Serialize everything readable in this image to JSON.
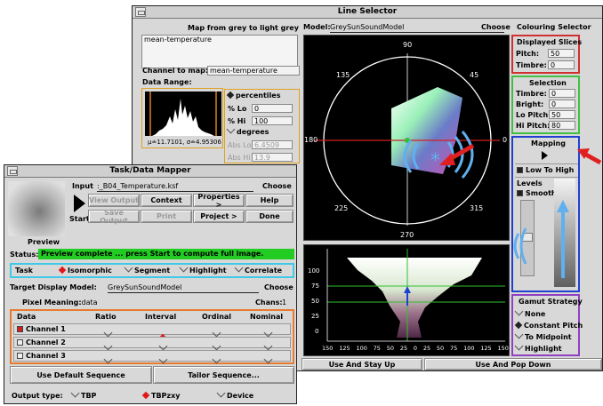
{
  "line_selector": {
    "title": "Line Selector",
    "map_header": "Map from grey to light grey",
    "map_list_item": "mean-temperature",
    "channel_label": "Channel to map:",
    "channel_value": "mean-temperature",
    "data_range_label": "Data Range:",
    "hist_stats": "μ≐11.7101, σ≐4.95306",
    "percentiles_label": "percentiles",
    "lo_label": "% Lo",
    "lo_value": "0",
    "hi_label": "% Hi",
    "hi_value": "100",
    "degrees_label": "degrees",
    "abs_lo_label": "Abs Lo",
    "abs_lo_value": "6.4509",
    "abs_hi_label": "Abs Hi",
    "abs_hi_value": "13.9",
    "model_label": "Model:",
    "model_value": "GreySunSoundModel",
    "choose_label": "Choose",
    "polar_labels": {
      "top": "90",
      "tr": "45",
      "left": "180",
      "right": "0",
      "bl": "225",
      "br": "315",
      "bottom": "270",
      "tl": "135"
    },
    "y_ticks": [
      "100",
      "75",
      "50",
      "25",
      "0"
    ],
    "x_ticks": [
      "150",
      "125",
      "100",
      "75",
      "50",
      "25",
      "0",
      "25",
      "50",
      "75",
      "100",
      "125",
      "150"
    ],
    "stay_up_label": "Use And Stay Up",
    "pop_down_label": "Use And Pop Down"
  },
  "colouring_selector": {
    "title": "Colouring Selector",
    "displayed_slices_label": "Displayed Slices",
    "pitch_label": "Pitch:",
    "pitch_value": "50",
    "timbre_label": "Timbre:",
    "timbre_value": "0",
    "selection_label": "Selection",
    "sel_timbre_label": "Timbre:",
    "sel_timbre_value": "0",
    "bright_label": "Bright:",
    "bright_value": "0",
    "lo_pitch_label": "Lo Pitch:",
    "lo_pitch_value": "50",
    "hi_pitch_label": "Hi Pitch:",
    "hi_pitch_value": "80",
    "mapping_label": "Mapping",
    "low_to_high_label": "Low To High",
    "levels_label": "Levels",
    "smooth_label": "Smooth",
    "gamut_label": "Gamut Strategy",
    "gamut_options": [
      "None",
      "Constant Pitch",
      "To Midpoint",
      "Highlight"
    ]
  },
  "task_mapper": {
    "title": "Task/Data Mapper",
    "input_label": "Input",
    "input_file": ":_B04_Temperature.ksf",
    "choose_label": "Choose",
    "start_label": "Start",
    "view_output_label": "View Output",
    "context_label": "Context",
    "properties_label": "Properties >",
    "help_label": "Help",
    "save_output_label": "Save Output",
    "print_label": "Print",
    "project_label": "Project >",
    "done_label": "Done",
    "preview_label": "Preview",
    "status_label": "Status:",
    "status_text": "Preview complete ... press Start to compute full image.",
    "task_label": "Task",
    "task_options": [
      "Isomorphic",
      "Segment",
      "Highlight",
      "Correlate"
    ],
    "target_model_label": "Target Display Model:",
    "target_model_value": "GreySunSoundModel",
    "target_choose_label": "Choose",
    "pixel_meaning_label": "Pixel Meaning:",
    "pixel_meaning_value": ".data",
    "chans_label": "Chans:",
    "chans_value": "1",
    "table_headers": [
      "Data",
      "Ratio",
      "Interval",
      "Ordinal",
      "Nominal"
    ],
    "channels": [
      "Channel 1",
      "Channel 2",
      "Channel 3"
    ],
    "default_seq_label": "Use Default Sequence",
    "tailor_seq_label": "Tailor Sequence...",
    "output_type_label": "Output type:",
    "output_options": [
      "TBP",
      "TBPzxy",
      "Device"
    ]
  },
  "colors": {
    "status_green": "#22cc22",
    "task_box": "#40c8e8",
    "channel_box": "#e87a30",
    "slices_box": "#d03030",
    "selection_box": "#40c040",
    "mapping_box": "#2040d0",
    "gamut_box": "#9040c0",
    "arrow_red": "#e02020",
    "wave_blue": "#60b0f0",
    "hist_box": "#e0a020"
  }
}
